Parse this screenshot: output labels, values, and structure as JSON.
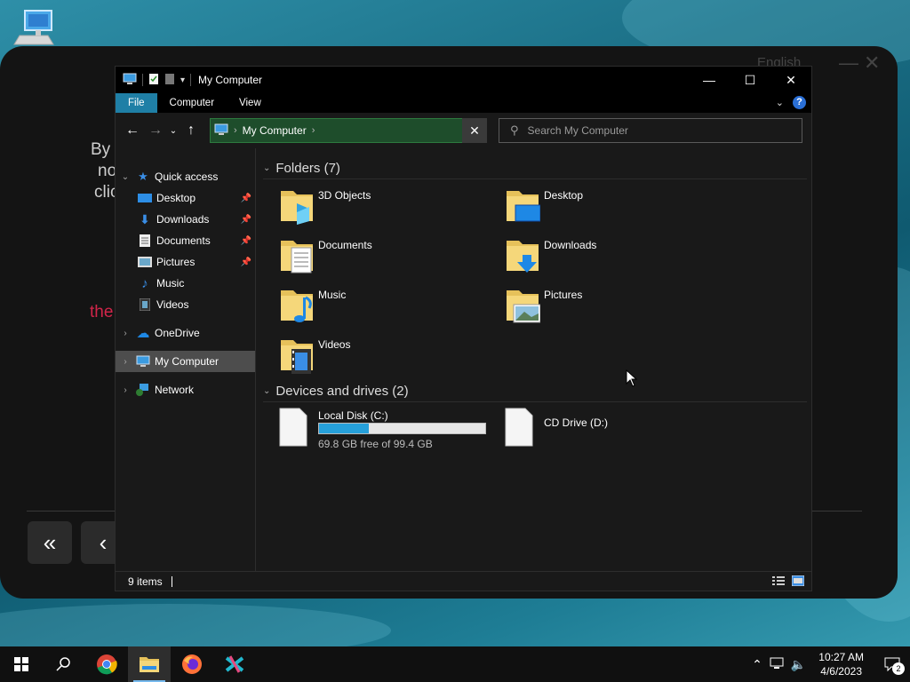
{
  "background_app": {
    "language": "English",
    "text_fragments": [
      "By",
      "no",
      "clic"
    ],
    "red_fragment": "the",
    "btn_first": "«",
    "btn_prev": "‹"
  },
  "window": {
    "title": "My Computer",
    "controls": {
      "minimize": "—",
      "maximize": "☐",
      "close": "✕"
    },
    "ribbon": {
      "tabs": [
        {
          "label": "File",
          "active": true
        },
        {
          "label": "Computer"
        },
        {
          "label": "View"
        }
      ],
      "help": "?"
    },
    "address": {
      "path": "My Computer",
      "search_placeholder": "Search My Computer"
    },
    "nav_pane": {
      "quick_access": "Quick access",
      "quick_items": [
        {
          "label": "Desktop",
          "pinned": true
        },
        {
          "label": "Downloads",
          "pinned": true
        },
        {
          "label": "Documents",
          "pinned": true
        },
        {
          "label": "Pictures",
          "pinned": true
        },
        {
          "label": "Music",
          "pinned": false
        },
        {
          "label": "Videos",
          "pinned": false
        }
      ],
      "onedrive": "OneDrive",
      "my_computer": "My Computer",
      "network": "Network"
    },
    "folders_header": "Folders (7)",
    "folders": [
      "3D Objects",
      "Desktop",
      "Documents",
      "Downloads",
      "Music",
      "Pictures",
      "Videos"
    ],
    "drives_header": "Devices and drives (2)",
    "drives": [
      {
        "name": "Local Disk (C:)",
        "free": "69.8 GB free of 99.4 GB",
        "used_fraction": 0.298
      },
      {
        "name": "CD Drive (D:)"
      }
    ],
    "status": "9 items"
  },
  "taskbar": {
    "clock_time": "10:27 AM",
    "clock_date": "4/6/2023",
    "notifications": "2"
  },
  "colors": {
    "accent": "#1f7fa6",
    "address_bg": "#1e4d2b",
    "drive_fill": "#26a0da",
    "window_bg": "#191919"
  }
}
